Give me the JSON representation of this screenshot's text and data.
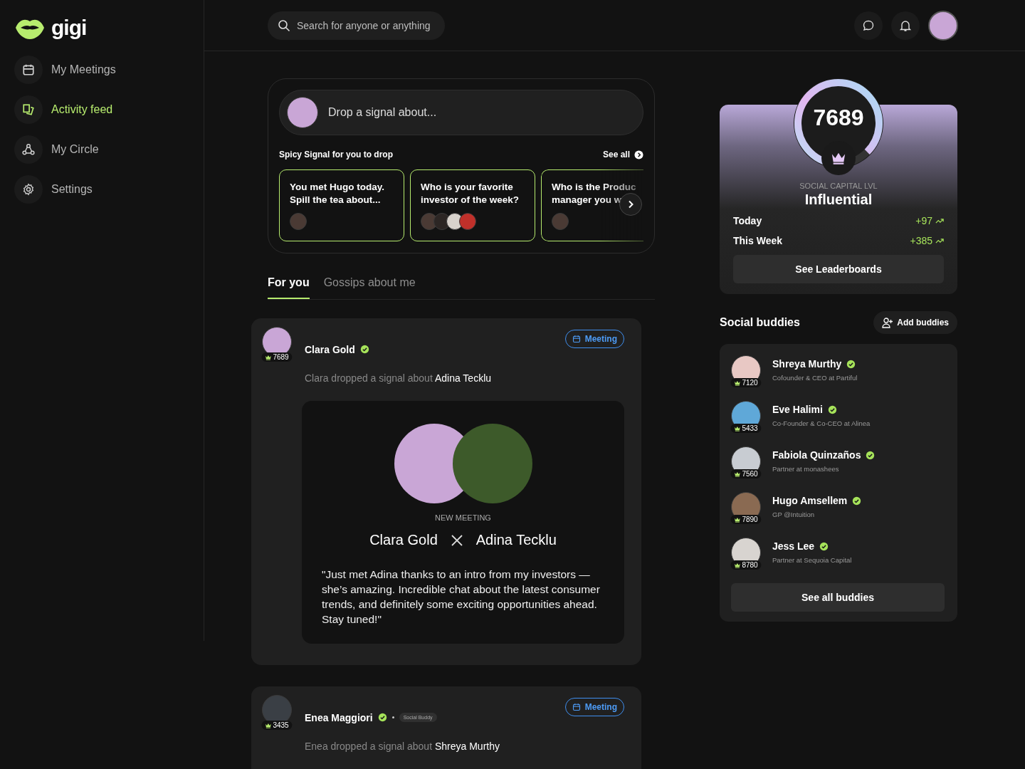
{
  "brand": {
    "name": "gigi"
  },
  "sidebar": {
    "items": [
      {
        "label": "My Meetings",
        "selected": false
      },
      {
        "label": "Activity feed",
        "selected": true
      },
      {
        "label": "My Circle",
        "selected": false
      },
      {
        "label": "Settings",
        "selected": false
      }
    ]
  },
  "search": {
    "placeholder": "Search for anyone or anything"
  },
  "composer": {
    "placeholder": "Drop a signal about..."
  },
  "spicy": {
    "title": "Spicy Signal for you to drop",
    "see_all": "See all",
    "cards": [
      {
        "lines": [
          "You met Hugo today.",
          "Spill the tea about..."
        ],
        "faded": false
      },
      {
        "lines": [
          "Who is your favorite",
          "investor of the week?"
        ],
        "faded": false
      },
      {
        "lines": [
          "Who is the Produc",
          "manager you w"
        ],
        "faded": true
      }
    ]
  },
  "tabs": [
    {
      "label": "For you",
      "selected": true
    },
    {
      "label": "Gossips about me",
      "selected": false
    }
  ],
  "posts": [
    {
      "author": "Clara Gold",
      "verified": true,
      "score": "7689",
      "tag": "Meeting",
      "action": "Clara dropped a signal about",
      "subject": "Adina Tecklu",
      "meeting": {
        "kicker": "NEW MEETING",
        "person_a": "Clara Gold",
        "person_b": "Adina Tecklu",
        "quote": "\"Just met Adina thanks to an intro from my investors — she’s amazing. Incredible chat about the latest consumer trends, and definitely some exciting opportunities ahead. Stay tuned!\""
      }
    },
    {
      "author": "Enea Maggiori",
      "verified": true,
      "score": "3435",
      "badge": "Social Buddy",
      "tag": "Meeting",
      "action": "Enea dropped a signal about",
      "subject": "Shreya Murthy"
    }
  ],
  "score": {
    "value": "7689",
    "level": 0.86,
    "label": "SOCIAL CAPITAL LVL",
    "tier": "Influential",
    "stats": [
      {
        "label": "Today",
        "value": "+97"
      },
      {
        "label": "This Week",
        "value": "+385"
      }
    ],
    "button": "See Leaderboards"
  },
  "buddies": {
    "title": "Social buddies",
    "add": "Add buddies",
    "button": "See all buddies",
    "items": [
      {
        "name": "Shreya Murthy",
        "verified": true,
        "role": "Cofounder & CEO at Partiful",
        "score": "7120"
      },
      {
        "name": "Eve Halimi",
        "verified": true,
        "role": "Co-Founder & Co-CEO at Alinea",
        "score": "5433"
      },
      {
        "name": "Fabiola Quinzaños",
        "verified": true,
        "role": "Partner at monashees",
        "score": "7560"
      },
      {
        "name": "Hugo Amsellem",
        "verified": true,
        "role": "GP @Intuition",
        "score": "7890"
      },
      {
        "name": "Jess Lee",
        "verified": true,
        "role": "Partner at Sequoia Capital",
        "score": "8780"
      }
    ]
  }
}
